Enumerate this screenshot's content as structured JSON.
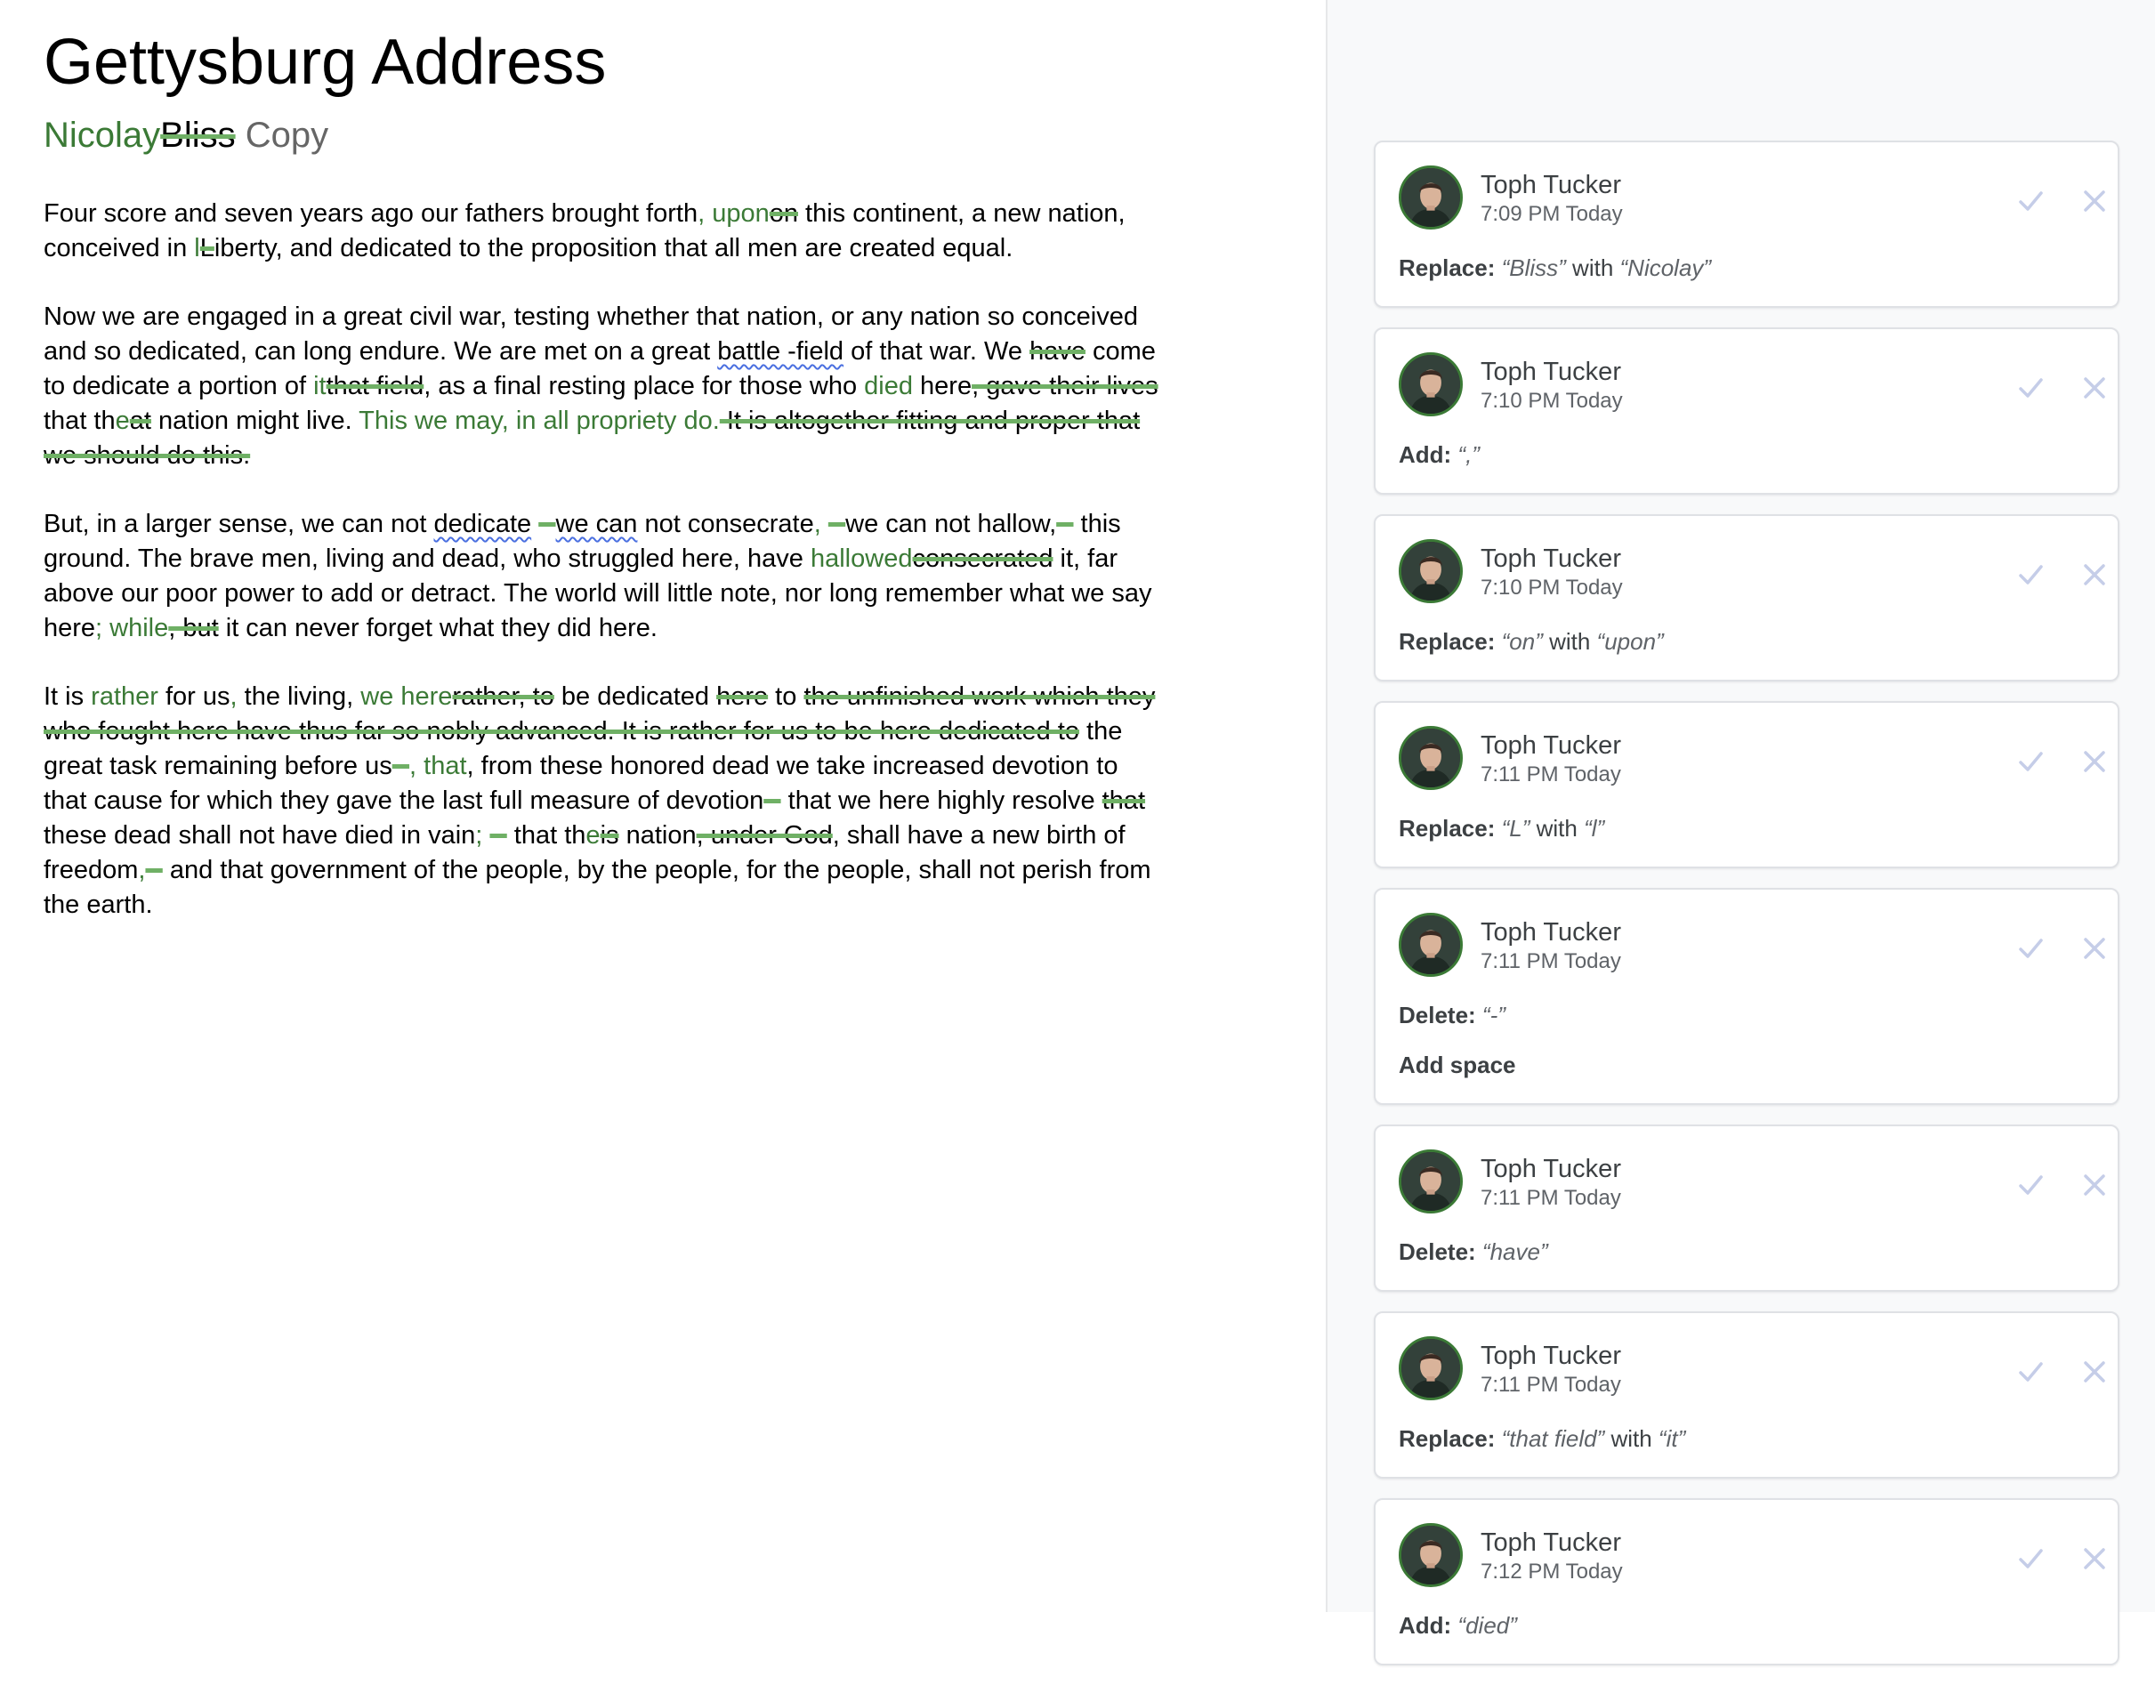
{
  "document": {
    "title": "Gettysburg Address",
    "subtitle": {
      "inserted": "Nicolay",
      "deleted": "Bliss",
      "rest": " Copy"
    },
    "paragraphs": [
      [
        {
          "t": "Four score and seven years ago our fathers brought forth"
        },
        {
          "t": ", upon",
          "k": "ins"
        },
        {
          "t": "on",
          "k": "del"
        },
        {
          "t": " this continent, a new nation, conceived in "
        },
        {
          "t": "l",
          "k": "ins"
        },
        {
          "t": "L",
          "k": "del"
        },
        {
          "t": "iberty, and dedicated to the proposition that all men are created equal."
        }
      ],
      [
        {
          "t": "Now we are engaged in a great civil war, testing whether that nation, or any nation so conceived and so dedicated, can long endure. We are met on a great "
        },
        {
          "t": "battle -field",
          "k": "squig"
        },
        {
          "t": " of that war. We "
        },
        {
          "t": "have",
          "k": "del"
        },
        {
          "t": " come to dedicate a portion of "
        },
        {
          "t": "it",
          "k": "ins"
        },
        {
          "t": "that field",
          "k": "del"
        },
        {
          "t": ", as a final resting place for those who "
        },
        {
          "t": "died",
          "k": "ins"
        },
        {
          "t": " here"
        },
        {
          "t": ", gave their lives",
          "k": "del"
        },
        {
          "t": " that th"
        },
        {
          "t": "e",
          "k": "ins"
        },
        {
          "t": "at",
          "k": "del"
        },
        {
          "t": " nation might live. "
        },
        {
          "t": "This we may, in all propriety do.",
          "k": "ins"
        },
        {
          "t": " It is altogether fitting and proper that we should do this.",
          "k": "del"
        }
      ],
      [
        {
          "t": "But, in a larger sense, we can not "
        },
        {
          "t": "dedicate",
          "k": "squig"
        },
        {
          "t": " "
        },
        {
          "t": "--",
          "k": "del"
        },
        {
          "t": "we can",
          "k": "squig"
        },
        {
          "t": " not consecrate"
        },
        {
          "t": ", ",
          "k": "ins"
        },
        {
          "t": "--",
          "k": "del"
        },
        {
          "t": "we can not hallow,"
        },
        {
          "t": "--",
          "k": "del"
        },
        {
          "t": " this ground. The brave men, living and dead, who struggled here, have "
        },
        {
          "t": "hallowed",
          "k": "ins"
        },
        {
          "t": "consecrated",
          "k": "del"
        },
        {
          "t": " it, far above our poor power to add or detract. The world will little note, nor long remember what we say here"
        },
        {
          "t": "; while",
          "k": "ins"
        },
        {
          "t": ", but",
          "k": "del"
        },
        {
          "t": " it can never forget what they did here."
        }
      ],
      [
        {
          "t": "It is "
        },
        {
          "t": "rather",
          "k": "ins"
        },
        {
          "t": " for us"
        },
        {
          "t": ",",
          "k": "ins"
        },
        {
          "t": " the living, "
        },
        {
          "t": "we here",
          "k": "ins"
        },
        {
          "t": "rather, to",
          "k": "del"
        },
        {
          "t": " be dedicated "
        },
        {
          "t": "here",
          "k": "del"
        },
        {
          "t": " to "
        },
        {
          "t": "the unfinished work which they who fought here have thus far so nobly advanced. It is rather for us to be here dedicated to",
          "k": "del"
        },
        {
          "t": " the great task remaining before us"
        },
        {
          "t": "--",
          "k": "del"
        },
        {
          "t": ", that",
          "k": "ins"
        },
        {
          "t": ", from these honored dead we take increased devotion to that cause for which they gave the last full measure of devotion"
        },
        {
          "t": "--",
          "k": "del"
        },
        {
          "t": " that we here highly resolve "
        },
        {
          "t": "that",
          "k": "del"
        },
        {
          "t": " these dead shall not have died in vain"
        },
        {
          "t": ";",
          "k": "ins"
        },
        {
          "t": " "
        },
        {
          "t": "--",
          "k": "del"
        },
        {
          "t": " that th"
        },
        {
          "t": "e",
          "k": "ins"
        },
        {
          "t": "is",
          "k": "del"
        },
        {
          "t": " nation"
        },
        {
          "t": ", under God",
          "k": "del"
        },
        {
          "t": ", shall have a new birth of freedom"
        },
        {
          "t": ",",
          "k": "ins"
        },
        {
          "t": "--",
          "k": "del"
        },
        {
          "t": " and that government of the people, by the people, for the people, shall not perish from the earth."
        }
      ]
    ]
  },
  "suggestions": [
    {
      "author": "Toph Tucker",
      "time": "7:09 PM Today",
      "lines": [
        {
          "kw": "Replace:",
          "parts": [
            {
              "q": "“Bliss”"
            },
            {
              "t": " with "
            },
            {
              "q": "“Nicolay”"
            }
          ]
        }
      ]
    },
    {
      "author": "Toph Tucker",
      "time": "7:10 PM Today",
      "lines": [
        {
          "kw": "Add:",
          "parts": [
            {
              "q": "“,”"
            }
          ]
        }
      ]
    },
    {
      "author": "Toph Tucker",
      "time": "7:10 PM Today",
      "lines": [
        {
          "kw": "Replace:",
          "parts": [
            {
              "q": "“on”"
            },
            {
              "t": " with "
            },
            {
              "q": "“upon”"
            }
          ]
        }
      ]
    },
    {
      "author": "Toph Tucker",
      "time": "7:11 PM Today",
      "lines": [
        {
          "kw": "Replace:",
          "parts": [
            {
              "q": "“L”"
            },
            {
              "t": " with "
            },
            {
              "q": "“l”"
            }
          ]
        }
      ]
    },
    {
      "author": "Toph Tucker",
      "time": "7:11 PM Today",
      "lines": [
        {
          "kw": "Delete:",
          "parts": [
            {
              "q": "“-”"
            }
          ]
        },
        {
          "kw": "Add space",
          "parts": []
        }
      ]
    },
    {
      "author": "Toph Tucker",
      "time": "7:11 PM Today",
      "lines": [
        {
          "kw": "Delete:",
          "parts": [
            {
              "q": "“have”"
            }
          ]
        }
      ]
    },
    {
      "author": "Toph Tucker",
      "time": "7:11 PM Today",
      "lines": [
        {
          "kw": "Replace:",
          "parts": [
            {
              "q": "“that field”"
            },
            {
              "t": " with "
            },
            {
              "q": "“it”"
            }
          ]
        }
      ]
    },
    {
      "author": "Toph Tucker",
      "time": "7:12 PM Today",
      "lines": [
        {
          "kw": "Add:",
          "parts": [
            {
              "q": "“died”"
            }
          ]
        }
      ]
    }
  ],
  "icons": {
    "accept": "check-icon",
    "reject": "close-icon",
    "avatar": "user-avatar"
  },
  "colors": {
    "inserted_text": "#3b7a36",
    "strike_line": "#6fb065",
    "avatar_ring": "#3b7a36",
    "action_icons": "#c5cde8",
    "panel_bg": "#f8f9fa"
  }
}
